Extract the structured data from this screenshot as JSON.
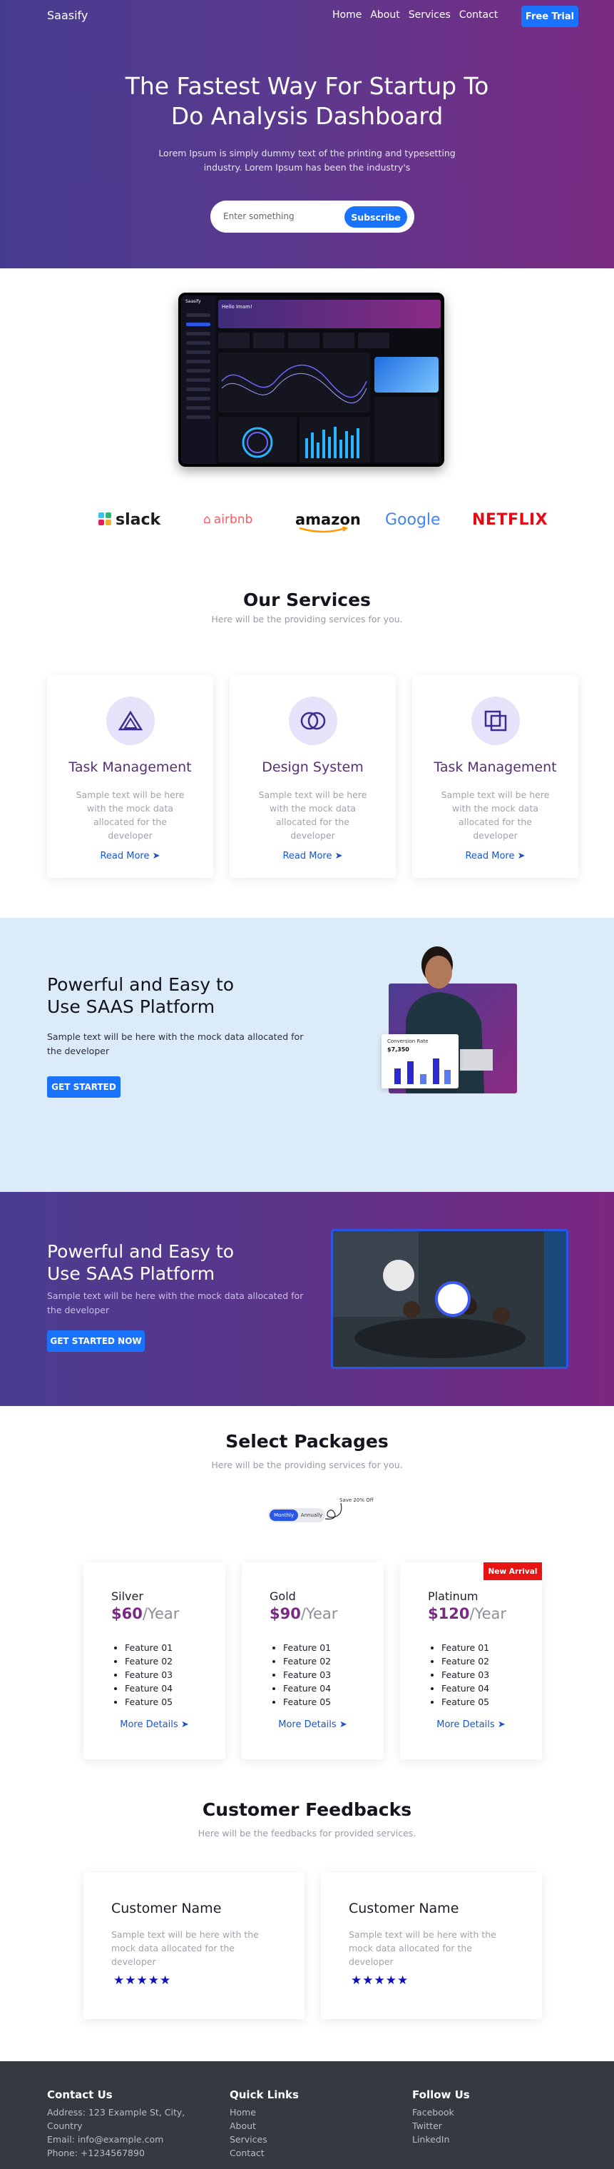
{
  "header": {
    "brand": "Saasify",
    "nav": [
      "Home",
      "About",
      "Services",
      "Contact"
    ],
    "cta": "Free Trial"
  },
  "hero": {
    "title_line1": "The Fastest Way For Startup To",
    "title_line2": "Do Analysis Dashboard",
    "lead": "Lorem Ipsum is simply dummy text of the printing and typesetting industry. Lorem Ipsum has been the industry's",
    "input_placeholder": "Enter something",
    "subscribe_label": "Subscribe"
  },
  "dashboard_mock": {
    "brand": "Saasify",
    "banner_title": "Hello Imam!"
  },
  "logos": [
    "slack",
    "airbnb",
    "amazon",
    "Google",
    "NETFLIX"
  ],
  "services": {
    "title": "Our Services",
    "subtitle": "Here will be the providing services for you.",
    "items": [
      {
        "title": "Task Management",
        "text": "Sample text will be here with the mock data allocated for the developer",
        "link": "Read More"
      },
      {
        "title": "Design System",
        "text": "Sample text will be here with the mock data allocated for the developer",
        "link": "Read More"
      },
      {
        "title": "Task Management",
        "text": "Sample text will be here with the mock data allocated for the developer",
        "link": "Read More"
      }
    ]
  },
  "powerful1": {
    "title": "Powerful and Easy to Use SAAS Platform",
    "text": "Sample text will be here with the mock data allocated for the developer",
    "button": "GET STARTED",
    "widget_title": "Conversion Rate",
    "widget_value": "$7,350"
  },
  "powerful2": {
    "title": "Powerful and Easy to Use SAAS Platform",
    "text": "Sample text will be here with the mock data allocated for the developer",
    "button": "GET STARTED NOW"
  },
  "packages": {
    "title": "Select Packages",
    "subtitle": "Here will be the providing services for you.",
    "toggle_monthly": "Monthly",
    "toggle_annually": "Annually",
    "save_note": "Save 20% Off",
    "plans": [
      {
        "name": "Silver",
        "price": "$60",
        "period": "/Year",
        "features": [
          "Feature 01",
          "Feature 02",
          "Feature 03",
          "Feature 04",
          "Feature 05"
        ],
        "link": "More Details"
      },
      {
        "name": "Gold",
        "price": "$90",
        "period": "/Year",
        "features": [
          "Feature 01",
          "Feature 02",
          "Feature 03",
          "Feature 04",
          "Feature 05"
        ],
        "link": "More Details"
      },
      {
        "name": "Platinum",
        "price": "$120",
        "period": "/Year",
        "features": [
          "Feature 01",
          "Feature 02",
          "Feature 03",
          "Feature 04",
          "Feature 05"
        ],
        "link": "More Details",
        "badge": "New Arrival"
      }
    ]
  },
  "feedback": {
    "title": "Customer Feedbacks",
    "subtitle": "Here will be the feedbacks for provided services.",
    "items": [
      {
        "name": "Customer Name",
        "text": "Sample text will be here with the mock data allocated for the developer",
        "stars": "★★★★★"
      },
      {
        "name": "Customer Name",
        "text": "Sample text will be here with the mock data allocated for the developer",
        "stars": "★★★★★"
      }
    ]
  },
  "footer": {
    "contact_title": "Contact Us",
    "address": "Address: 123 Example St, City, Country",
    "email": "Email: info@example.com",
    "phone": "Phone: +1234567890",
    "links_title": "Quick Links",
    "links": [
      "Home",
      "About",
      "Services",
      "Contact"
    ],
    "follow_title": "Follow Us",
    "social": [
      "Facebook",
      "Twitter",
      "LinkedIn"
    ]
  },
  "colors": {
    "accent": "#1a73ff",
    "purple": "#7a2a82",
    "footer_bg": "#343a40"
  }
}
